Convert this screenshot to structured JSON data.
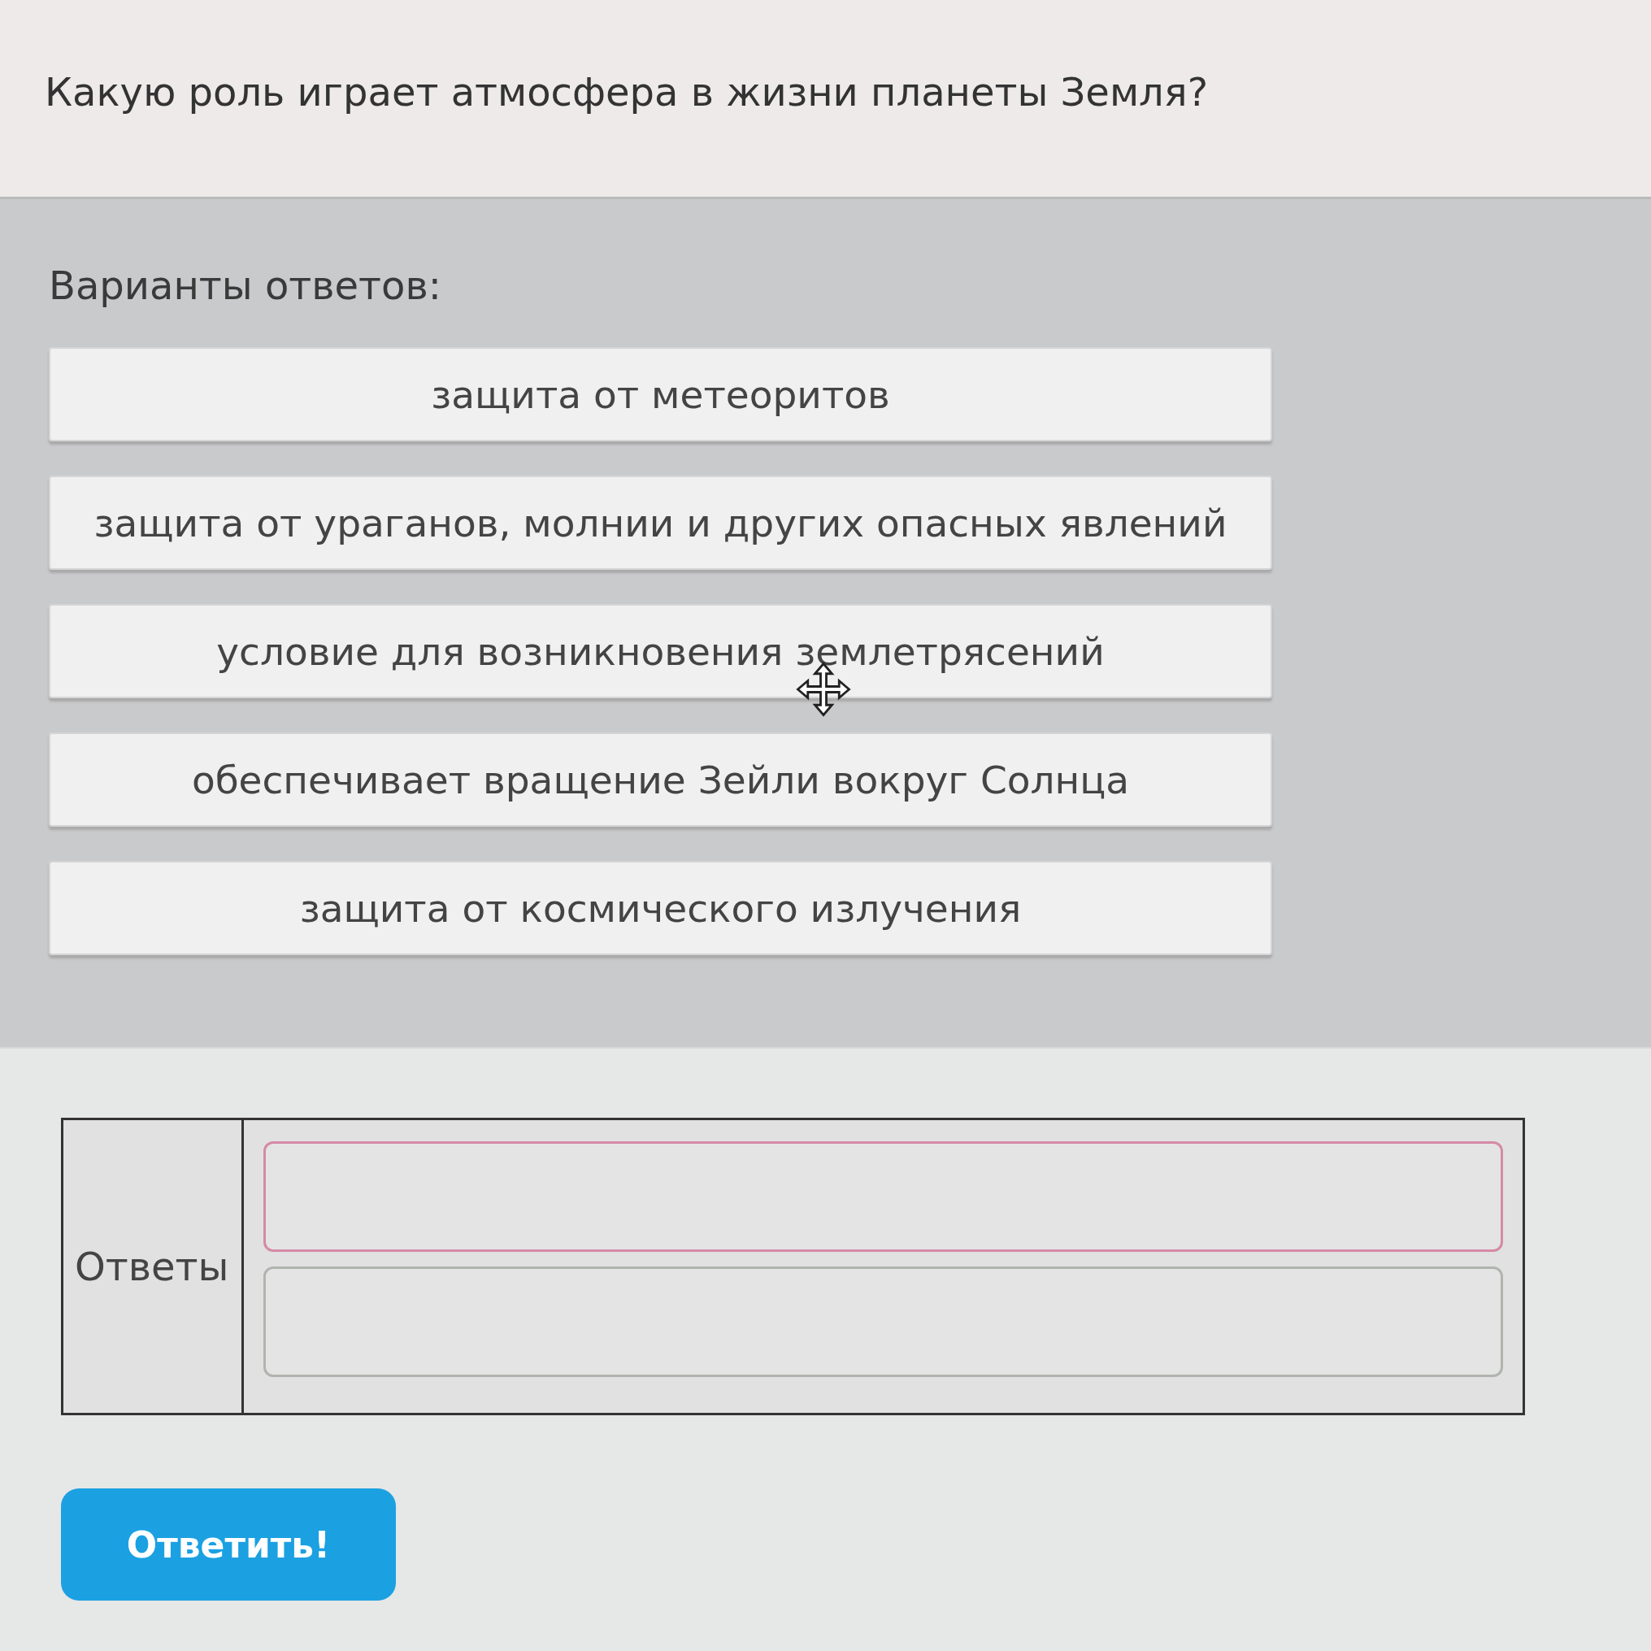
{
  "question": "Какую роль играет атмосфера в жизни планеты Земля?",
  "options_title": "Варианты ответов:",
  "options": [
    "защита от метеоритов",
    "защита от ураганов, молнии и других опасных явлений",
    "условие для возникновения землетрясений",
    "обеспечивает вращение Зейли вокруг Солнца",
    "защита от космического излучения"
  ],
  "answers": {
    "label": "Ответы",
    "slots": [
      {
        "highlighted": true
      },
      {
        "highlighted": false
      }
    ]
  },
  "submit": "Ответить!"
}
